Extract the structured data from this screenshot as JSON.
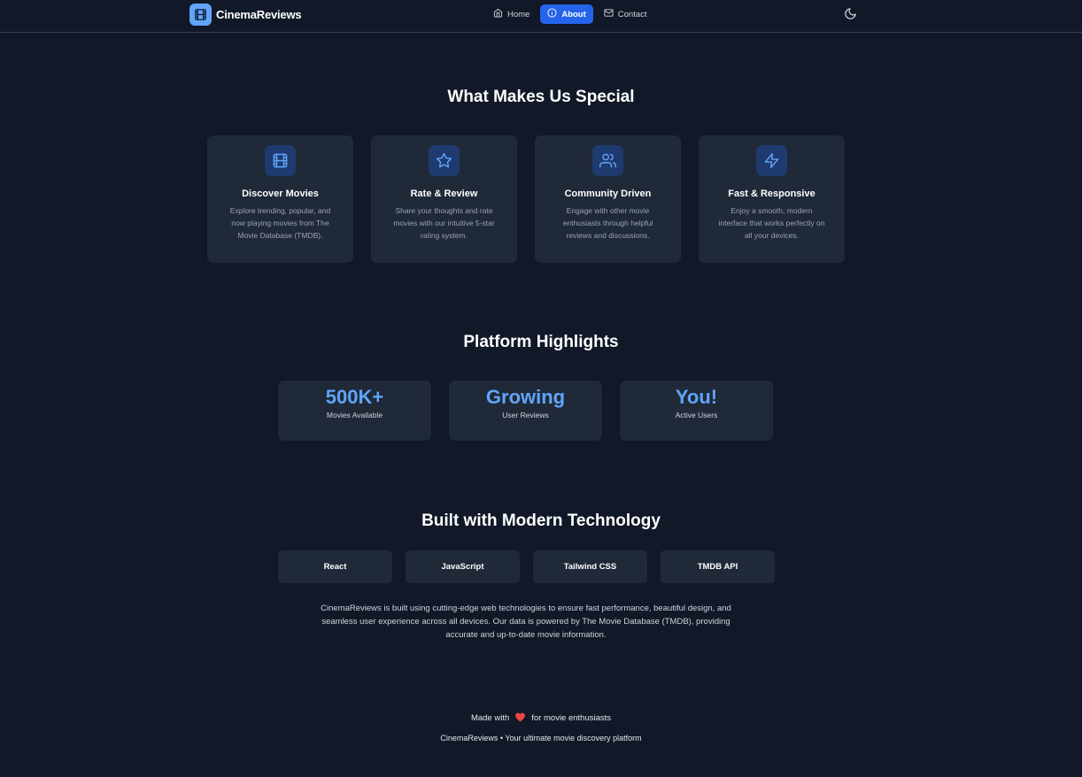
{
  "app": {
    "name": "CinemaReviews",
    "brand_color": "#60a5fa",
    "accent_color": "#2563eb",
    "logo_icon": "film-icon"
  },
  "nav": {
    "items": [
      {
        "label": "Home",
        "icon": "home-icon",
        "active": false
      },
      {
        "label": "About",
        "icon": "info-icon",
        "active": true
      },
      {
        "label": "Contact",
        "icon": "mail-icon",
        "active": false
      }
    ],
    "theme_toggle_icon": "moon-icon"
  },
  "features": {
    "title": "What Makes Us Special",
    "items": [
      {
        "icon": "film-icon",
        "title": "Discover Movies",
        "description": "Explore trending, popular, and now playing movies from The Movie Database (TMDB)."
      },
      {
        "icon": "star-icon",
        "title": "Rate & Review",
        "description": "Share your thoughts and rate movies with our intuitive 5-star rating system."
      },
      {
        "icon": "users-icon",
        "title": "Community Driven",
        "description": "Engage with other movie enthusiasts through helpful reviews and discussions."
      },
      {
        "icon": "lightning-icon",
        "title": "Fast & Responsive",
        "description": "Enjoy a smooth, modern interface that works perfectly on all your devices."
      }
    ]
  },
  "highlights": {
    "title": "Platform Highlights",
    "items": [
      {
        "value": "500K+",
        "label": "Movies Available"
      },
      {
        "value": "Growing",
        "label": "User Reviews"
      },
      {
        "value": "You!",
        "label": "Active Users"
      }
    ]
  },
  "technology": {
    "title": "Built with Modern Technology",
    "items": [
      "React",
      "JavaScript",
      "Tailwind CSS",
      "TMDB API"
    ],
    "description": "CinemaReviews is built using cutting-edge web technologies to ensure fast performance, beautiful design, and seamless user experience across all devices. Our data is powered by The Movie Database (TMDB), providing accurate and up-to-date movie information."
  },
  "footer": {
    "made_with_prefix": "Made with",
    "heart_icon": "heart-icon",
    "made_with_suffix": "for movie enthusiasts",
    "tagline": "CinemaReviews • Your ultimate movie discovery platform"
  }
}
